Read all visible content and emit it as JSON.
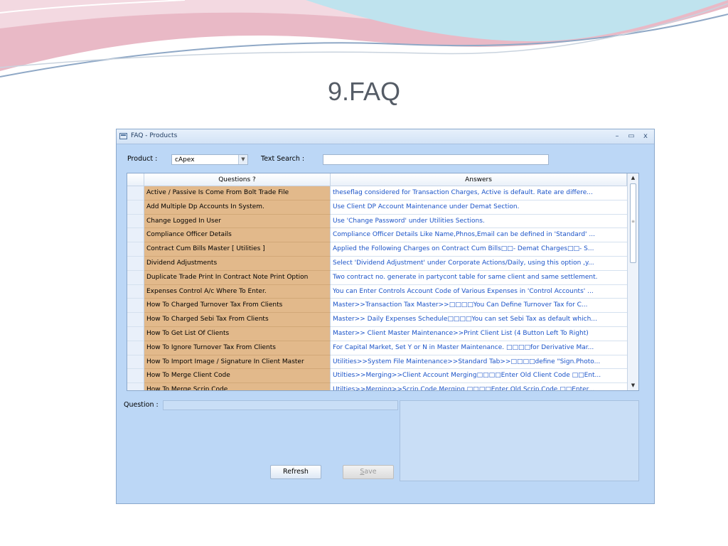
{
  "slide": {
    "title": "9.FAQ"
  },
  "window": {
    "title": "FAQ - Products",
    "minimize_glyph": "–",
    "maximize_glyph": "▭",
    "close_glyph": "x"
  },
  "filters": {
    "product_label": "Product :",
    "product_value": "cApex",
    "text_search_label": "Text Search :",
    "text_search_value": ""
  },
  "grid": {
    "columns": [
      "Questions ?",
      "Answers"
    ],
    "rows": [
      {
        "question": "Active / Passive Is Come From Bolt Trade File",
        "answer": "theseflag considered for Transaction Charges, Active is default. Rate are differe..."
      },
      {
        "question": "Add Multiple Dp Accounts In System.",
        "answer": "Use Client DP Account Maintenance under Demat Section."
      },
      {
        "question": "Change Logged In User",
        "answer": "Use 'Change Password' under Utilities Sections."
      },
      {
        "question": "Compliance Officer Details",
        "answer": "Compliance Officer Details Like Name,Phnos,Email can be defined in 'Standard' ..."
      },
      {
        "question": "Contract Cum Bills Master [ Utilities ]",
        "answer": "Applied the Following Charges on Contract Cum Bills□□- Demat Charges□□- S..."
      },
      {
        "question": "Dividend Adjustments",
        "answer": "Select 'Dividend Adjustment' under Corporate Actions/Daily, using this option ,y..."
      },
      {
        "question": "Duplicate Trade Print In Contract Note Print Option",
        "answer": "Two contract no. generate in partycont table for same client and same settlement."
      },
      {
        "question": "Expenses Control A/c Where To Enter.",
        "answer": "You can Enter Controls Account Code of Various Expenses in 'Control Accounts' ..."
      },
      {
        "question": "How To  Charged Turnover Tax From Clients",
        "answer": "Master>>Transaction  Tax Master>>□□□□You Can Define Turnover Tax for C..."
      },
      {
        "question": "How To Charged Sebi Tax From Clients",
        "answer": "Master>> Daily Expenses Schedule□□□□You can set Sebi Tax as default which..."
      },
      {
        "question": "How To Get List Of Clients",
        "answer": "Master>> Client Master Maintenance>>Print Client List (4 Button Left To Right)"
      },
      {
        "question": "How To Ignore Turnover Tax From Clients",
        "answer": "For Capital Market, Set Y or N in Master Maintenance. □□□□for Derivative Mar..."
      },
      {
        "question": "How To Import Image / Signature In Client Master",
        "answer": "Utilities>>System File Maintenance>>Standard Tab>>□□□□define \"Sign.Photo..."
      },
      {
        "question": "How To Merge Client Code",
        "answer": "Utilties>>Merging>>Client Account Merging□□□□Enter Old Client Code □□Ent..."
      },
      {
        "question": "How To Merge Scrip Code",
        "answer": "Utilties>>Merging>>Scrip Code Merging □□□□Enter Old Scrip Code □□Enter..."
      }
    ]
  },
  "detail": {
    "question_label": "Question :"
  },
  "buttons": {
    "refresh": "Refresh",
    "save_first": "S",
    "save_rest": "ave"
  }
}
